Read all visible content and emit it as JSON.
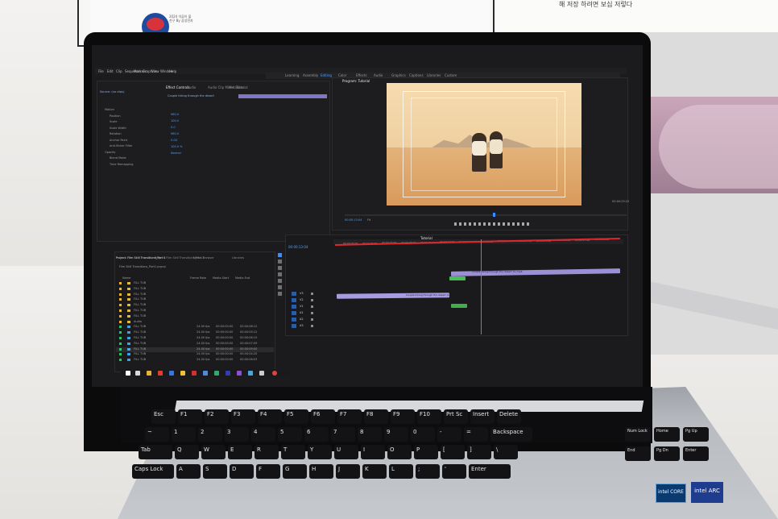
{
  "background": {
    "korean_text": "해 저장 하려면 보십 저렇다",
    "sticker_label": "2024 이끔이 불친구 By 삼성전자"
  },
  "premiere": {
    "menu": [
      "File",
      "Edit",
      "Clip",
      "Sequence",
      "Markers",
      "Graphics",
      "View",
      "Window",
      "Help"
    ],
    "workspaces": [
      "Learning",
      "Assembly",
      "Editing",
      "Color",
      "Effects",
      "Audio",
      "Graphics",
      "Captions",
      "Libraries",
      "Custom"
    ],
    "active_workspace": "Editing",
    "left_panel_tabs": [
      "Effect Controls",
      "Audio",
      "Audio Clip Mixer: Tutorial",
      "Metadata"
    ],
    "source_label": "Source: (no clips)",
    "clip_title": "Couple hiking through the desert",
    "effect_rows": [
      "Motion",
      "Position",
      "Scale",
      "Scale Width",
      "Rotation",
      "Anchor Point",
      "Anti-flicker Filter",
      "Opacity",
      "Blend Mode",
      "Time Remapping"
    ],
    "effect_values": [
      "960.0",
      "100.0",
      "0.0",
      "960.0",
      "0.00",
      "100.0 %",
      "Normal"
    ],
    "program_tab": "Program: Tutorial",
    "program_timecode": "00:00:13:04",
    "program_duration": "00:00:25:22",
    "program_fit": "Fit",
    "timeline_tab": "Tutorial",
    "timeline_timecode": "00:00:13:04",
    "ruler_ticks": [
      "00:00:05:00",
      "00:00:06:00",
      "00:00:07:00",
      "00:00:08:00",
      "00:00:09:00",
      "00:00:10:00",
      "00:00:11:00",
      "00:00:12:00",
      "00:00:13:00",
      "00:00:14:00",
      "00:00:15:00",
      "00:00:16:00",
      "00:00:17:00",
      "00:00:18:00"
    ],
    "clip_v2_label": "Couple hiking through the desert (1).mp4",
    "clip_v1_label": "Couple hiking through the desert (1).mp4",
    "project_tabs": [
      "Project: Film Skill Transitions_Part 1",
      "Project: Film Skill Transitions_Part 2",
      "Media Browser",
      "Libraries"
    ],
    "project_name": "Film Skill Transitions_Part1.prproj",
    "project_columns": [
      "Name",
      "Frame Rate",
      "Media Start",
      "Media End"
    ],
    "project_items": [
      {
        "name": "FILL TUB",
        "type": "folder",
        "rate": "",
        "start": "",
        "end": ""
      },
      {
        "name": "FILL TUB",
        "type": "folder",
        "rate": "",
        "start": "",
        "end": ""
      },
      {
        "name": "FILL TUB",
        "type": "folder",
        "rate": "",
        "start": "",
        "end": ""
      },
      {
        "name": "FILL TUB",
        "type": "folder",
        "rate": "",
        "start": "",
        "end": ""
      },
      {
        "name": "FILL TUB",
        "type": "folder",
        "rate": "",
        "start": "",
        "end": ""
      },
      {
        "name": "FILL TUB",
        "type": "folder",
        "rate": "",
        "start": "",
        "end": ""
      },
      {
        "name": "FILL TUB",
        "type": "folder",
        "rate": "",
        "start": "",
        "end": ""
      },
      {
        "name": "Audio",
        "type": "folder",
        "rate": "",
        "start": "",
        "end": ""
      },
      {
        "name": "FILL TUB",
        "type": "clip",
        "rate": "24.00 fps",
        "start": "00:00:00:00",
        "end": "00:00:08:12"
      },
      {
        "name": "FILL TUB",
        "type": "clip",
        "rate": "24.00 fps",
        "start": "00:00:00:00",
        "end": "00:00:05:12"
      },
      {
        "name": "FILL TUB",
        "type": "clip",
        "rate": "24.00 fps",
        "start": "00:00:00:00",
        "end": "00:00:06:15"
      },
      {
        "name": "FILL TUB",
        "type": "clip",
        "rate": "24.00 fps",
        "start": "00:00:00:00",
        "end": "00:00:07:09"
      },
      {
        "name": "FILL TUB",
        "type": "clip",
        "rate": "24.00 fps",
        "start": "00:00:00:00",
        "end": "00:00:09:00"
      },
      {
        "name": "FILL TUB",
        "type": "clip",
        "rate": "24.00 fps",
        "start": "00:00:00:00",
        "end": "00:00:04:20"
      },
      {
        "name": "FILL TUB",
        "type": "clip",
        "rate": "24.00 fps",
        "start": "00:00:00:00",
        "end": "00:00:06:03"
      }
    ],
    "track_labels": [
      "V3",
      "V2",
      "V1",
      "A1",
      "A2",
      "A3"
    ]
  },
  "keyboard": {
    "rows": [
      [
        "Esc",
        "F1",
        "F2",
        "F3",
        "F4",
        "F5",
        "F6",
        "F7",
        "F8",
        "F9",
        "F10",
        "Prt Sc",
        "Insert",
        "Delete"
      ],
      [
        "~",
        "1",
        "2",
        "3",
        "4",
        "5",
        "6",
        "7",
        "8",
        "9",
        "0",
        "-",
        "=",
        "Backspace"
      ],
      [
        "Tab",
        "Q",
        "W",
        "E",
        "R",
        "T",
        "Y",
        "U",
        "I",
        "O",
        "P",
        "[",
        "]",
        "\\"
      ],
      [
        "Caps Lock",
        "A",
        "S",
        "D",
        "F",
        "G",
        "H",
        "J",
        "K",
        "L",
        ";",
        "'",
        "Enter"
      ]
    ],
    "numpad_labels": [
      "Num Lock",
      "Home",
      "Pg Up",
      "End",
      "Pg Dn",
      "Enter"
    ],
    "badge_intel": "intel CORE",
    "badge_arc": "intel ARC"
  }
}
